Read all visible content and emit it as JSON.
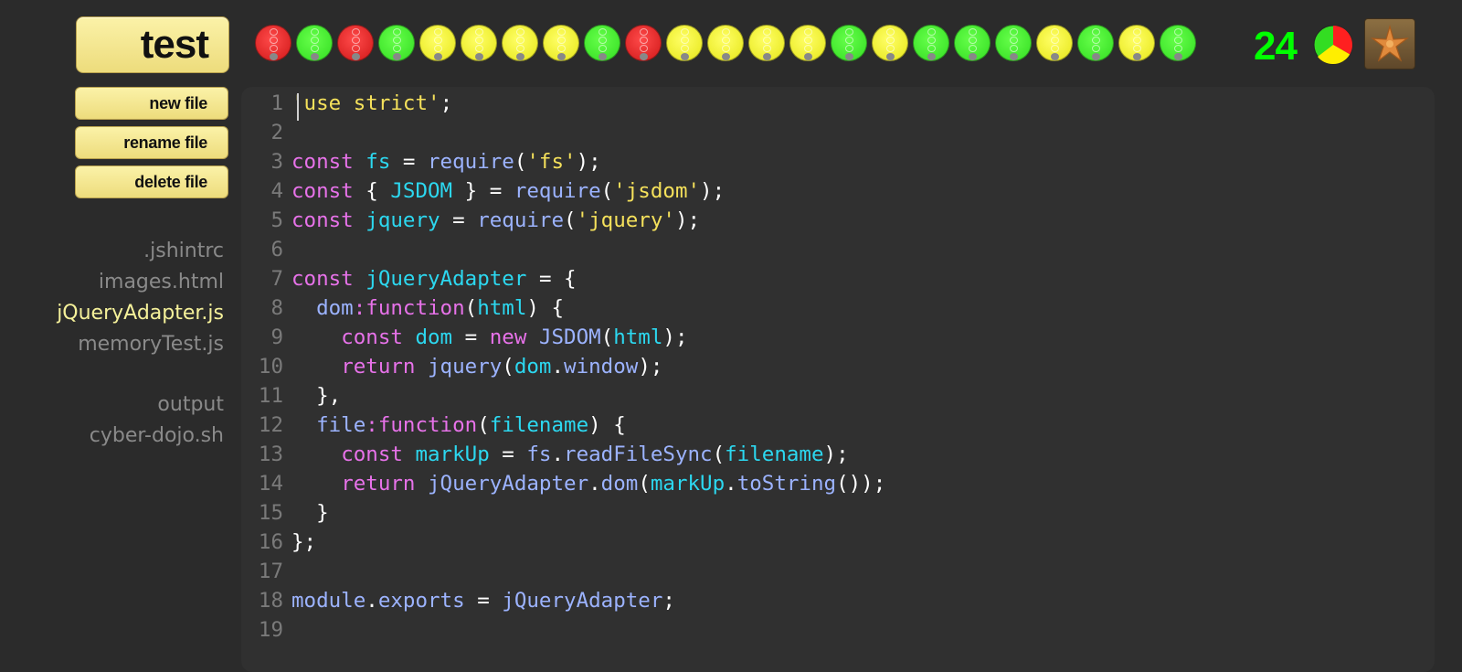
{
  "header": {
    "test_label": "test",
    "light_count": "24",
    "lights": [
      "red",
      "green",
      "red",
      "green",
      "amber",
      "amber",
      "amber",
      "amber",
      "green",
      "red",
      "amber",
      "amber",
      "amber",
      "amber",
      "green",
      "amber",
      "green",
      "green",
      "green",
      "amber",
      "green",
      "amber",
      "green"
    ],
    "pie_colors": {
      "red": "#ff2020",
      "green": "#33dd22",
      "amber": "#ffee00"
    },
    "avatar_icon": "starfish-icon"
  },
  "sidebar": {
    "new_file": "new file",
    "rename_file": "rename file",
    "delete_file": "delete file",
    "files": [
      ".jshintrc",
      "images.html",
      "jQueryAdapter.js",
      "memoryTest.js"
    ],
    "selected_file": "jQueryAdapter.js",
    "outputs": [
      "output",
      "cyber-dojo.sh"
    ]
  },
  "editor": {
    "language": "javascript",
    "lines": [
      "'use strict';",
      "",
      "const fs = require('fs');",
      "const { JSDOM } = require('jsdom');",
      "const jquery = require('jquery');",
      "",
      "const jQueryAdapter = {",
      "  dom:function(html) {",
      "    const dom = new JSDOM(html);",
      "    return jquery(dom.window);",
      "  },",
      "  file:function(filename) {",
      "    const markUp = fs.readFileSync(filename);",
      "    return jQueryAdapter.dom(markUp.toString());",
      "  }",
      "};",
      "",
      "module.exports = jQueryAdapter;",
      ""
    ]
  }
}
